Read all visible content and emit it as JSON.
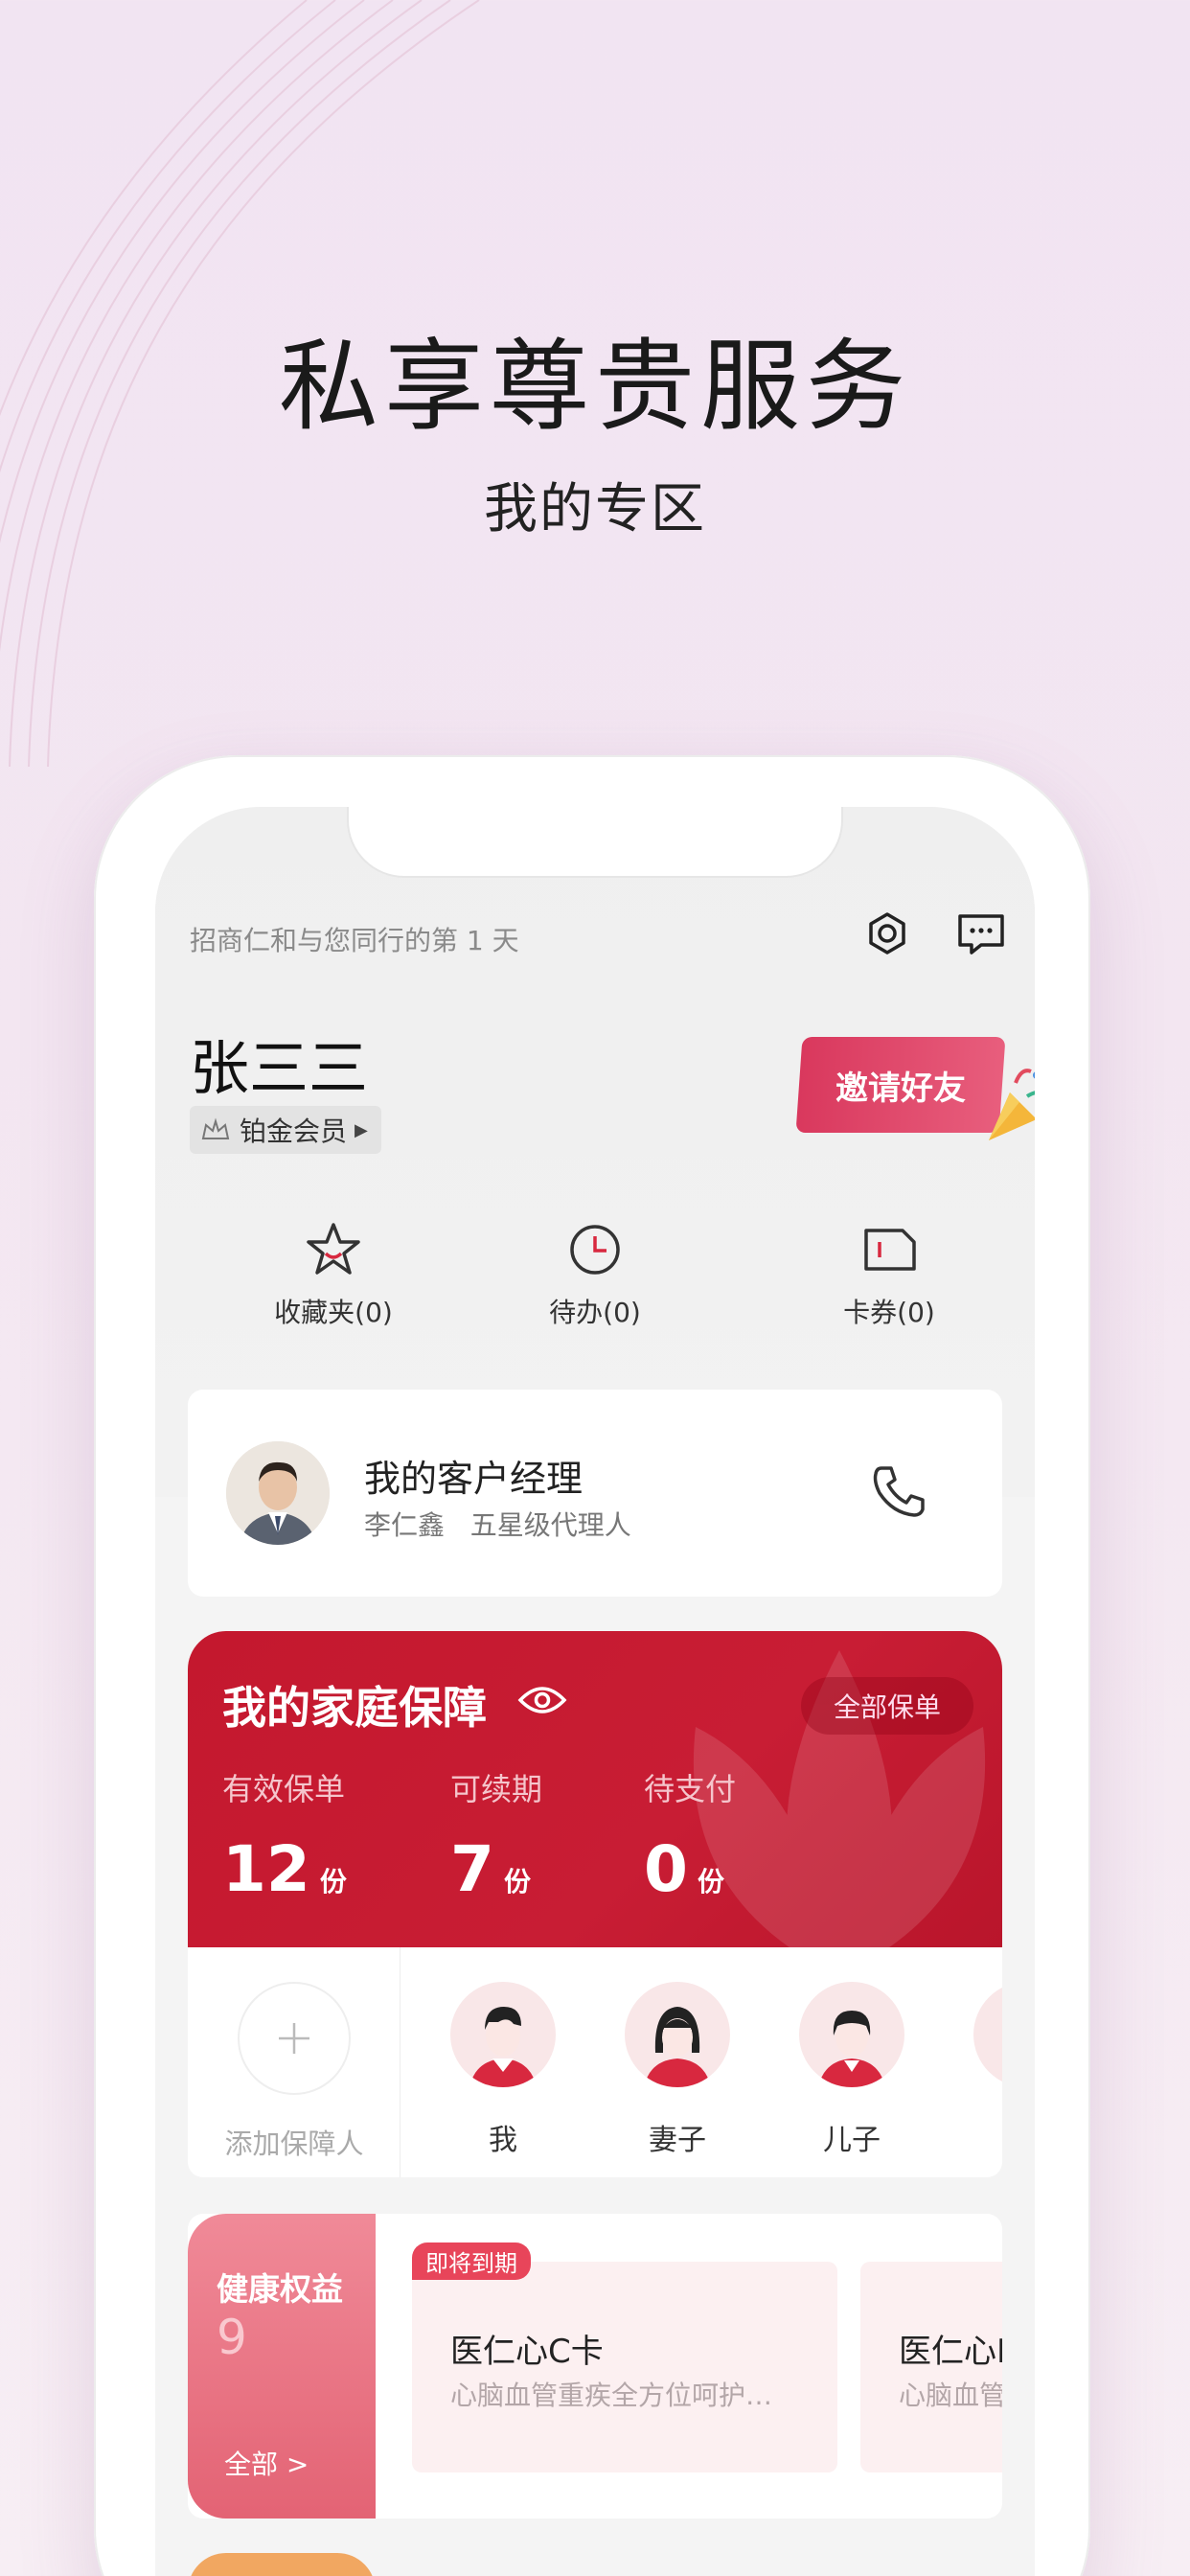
{
  "hero": {
    "title": "私享尊贵服务",
    "subtitle": "我的专区"
  },
  "header": {
    "days_text": "招商仁和与您同行的第 1 天",
    "icons": [
      "settings-icon",
      "message-icon"
    ]
  },
  "profile": {
    "name": "张三三",
    "member_level": "铂金会员",
    "invite_label": "邀请好友"
  },
  "quick_links": [
    {
      "label": "收藏夹(0)",
      "icon": "star-icon"
    },
    {
      "label": "待办(0)",
      "icon": "clock-icon"
    },
    {
      "label": "卡券(0)",
      "icon": "coupon-icon"
    }
  ],
  "manager": {
    "title": "我的客户经理",
    "name": "李仁鑫",
    "rank": "五星级代理人",
    "icon": "phone-icon"
  },
  "family": {
    "title": "我的家庭保障",
    "all_label": "全部保单",
    "stats": [
      {
        "label": "有效保单",
        "value": "12",
        "unit": "份"
      },
      {
        "label": "可续期",
        "value": "7",
        "unit": "份"
      },
      {
        "label": "待支付",
        "value": "0",
        "unit": "份"
      }
    ],
    "colors": {
      "primary": "#c4182e"
    }
  },
  "members": {
    "add_label": "添加保障人",
    "list": [
      {
        "label": "我"
      },
      {
        "label": "妻子"
      },
      {
        "label": "儿子"
      }
    ]
  },
  "health": {
    "title": "健康权益",
    "count": "9",
    "all_label": "全部 >",
    "benefits": [
      {
        "tag": "即将到期",
        "name": "医仁心C卡",
        "desc": "心脑血管重疾全方位呵护…"
      },
      {
        "name": "医仁心D",
        "desc": "心脑血管"
      }
    ]
  }
}
